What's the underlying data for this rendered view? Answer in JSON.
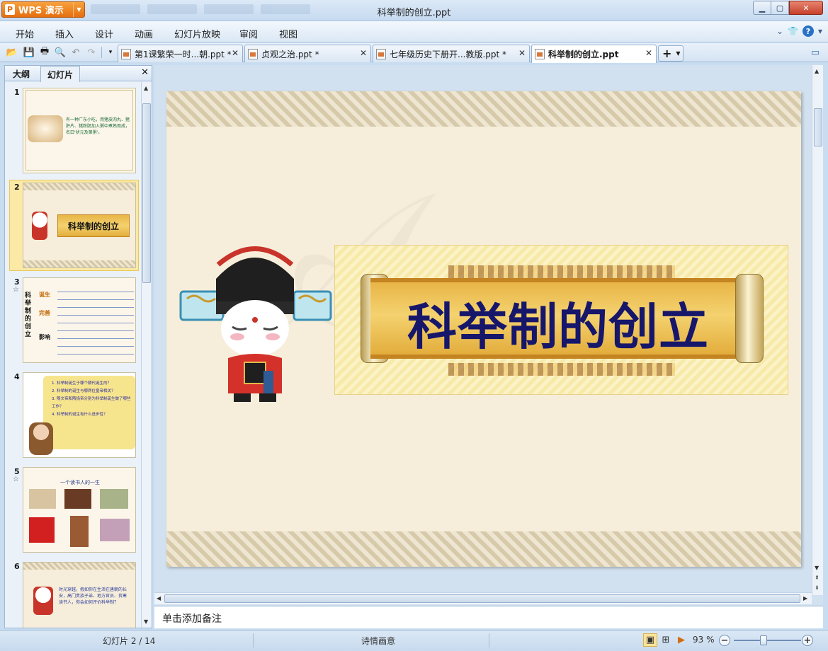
{
  "titlebar": {
    "app_name": "WPS 演示",
    "window_title": "科举制的创立.ppt"
  },
  "menu": {
    "items": [
      "开始",
      "插入",
      "设计",
      "动画",
      "幻灯片放映",
      "审阅",
      "视图"
    ]
  },
  "doc_tabs": [
    {
      "label": "第1课繁荣一时...朝.ppt *"
    },
    {
      "label": "贞观之治.ppt *"
    },
    {
      "label": "七年级历史下册开...教版.ppt *"
    },
    {
      "label": "科举制的创立.ppt",
      "active": true
    }
  ],
  "left_panel": {
    "tab_outline": "大纲",
    "tab_slides": "幻灯片",
    "thumbnails": [
      {
        "num": "1",
        "text": "有一种广东小吃，用猪皮肉丸、猪肝片、猪粉肠加入粥中煮熟而成，名曰'状元及第粥'。"
      },
      {
        "num": "2",
        "title": "科举制的创立",
        "selected": true
      },
      {
        "num": "3",
        "star": "☆",
        "vertical": "科举制的创立",
        "tags": [
          "诞生",
          "完善",
          "影响"
        ]
      },
      {
        "num": "4",
        "lines": [
          "1. 科举制诞生于哪个朝代诞生的？",
          "2. 科举制的诞生与哪两位皇帝相关？",
          "3. 隋文帝和隋炀帝分别为科举制诞生做了哪些工作？",
          "4. 科举制的诞生有什么进步性？"
        ]
      },
      {
        "num": "5",
        "star": "☆",
        "title": "一个读书人的一生"
      },
      {
        "num": "6",
        "text": "时光穿越，假如你在生活在唐朝的长安，高门贵族子弟、地方官员、贫寒读书人，你会如何评价科举制？"
      }
    ]
  },
  "slide": {
    "title": "科举制的创立"
  },
  "notes_placeholder": "单击添加备注",
  "status": {
    "slide_info": "幻灯片 2 / 14",
    "theme": "诗情画意",
    "zoom": "93 %"
  }
}
